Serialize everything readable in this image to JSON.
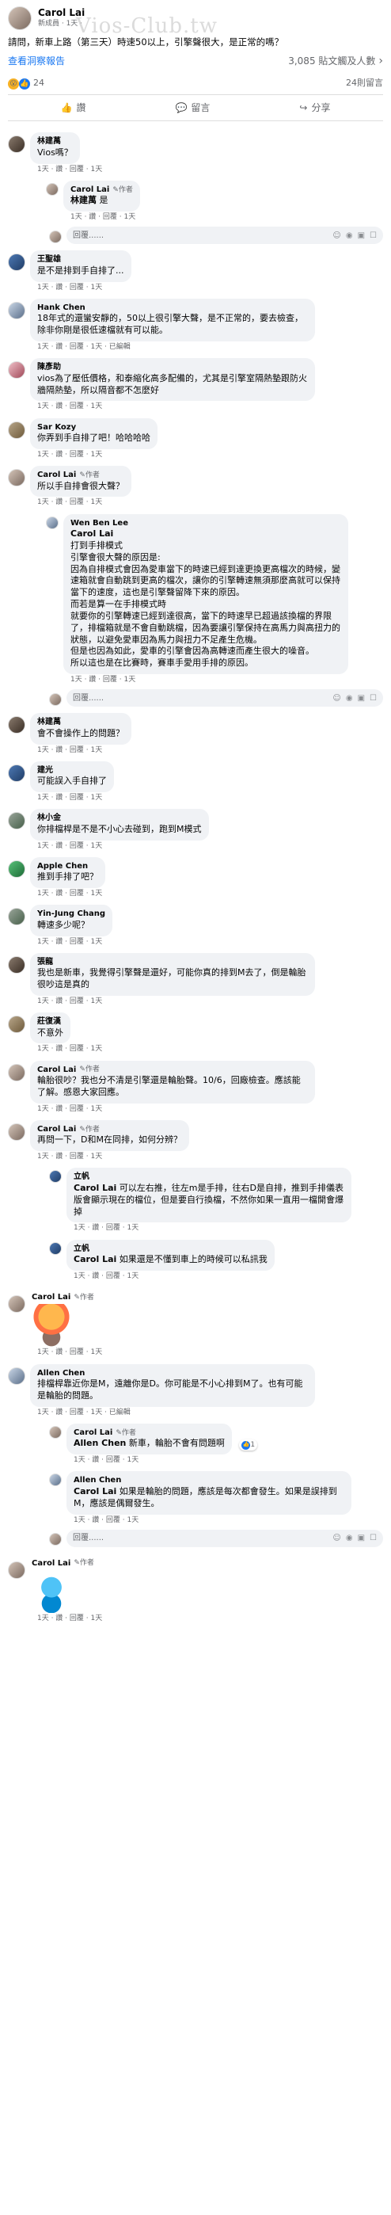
{
  "post": {
    "author": "Carol Lai",
    "meta": "新成員 · 1天 ·",
    "text": "請問，新車上路（第三天）時速50以上，引擎聲很大，是正常的嗎？",
    "watermark": "Vios-Club.tw",
    "see_insights": "查看洞察報告",
    "reach": "3,085 貼文觸及人數",
    "reaction_count": "24",
    "comment_count": "24則留言"
  },
  "actions": {
    "like": "讚",
    "comment": "留言",
    "share": "分享"
  },
  "comments": [
    {
      "id": "c1",
      "name": "林建萬",
      "text": "Vios嗎？",
      "meta": "1天 · 讚 · 回覆 · 1天"
    },
    {
      "id": "c1r1",
      "name": "Carol Lai",
      "author": "作者",
      "tag": "林建萬",
      "text": " 是",
      "meta": "1天 · 讚 · 回覆 · 1天"
    },
    {
      "id": "c2",
      "name": "王聖雄",
      "text": "是不是排到手自排了...",
      "meta": "1天 · 讚 · 回覆 · 1天"
    },
    {
      "id": "c3",
      "name": "Hank Chen",
      "text": "18年式的還蠻安靜的，50以上很引擎大聲，是不正常的，要去檢查，除非你剛是很低速檔就有可以能。",
      "meta": "1天 · 讚 · 回覆 · 1天 · 已編輯"
    },
    {
      "id": "c4",
      "name": "陳彥助",
      "text": "vios為了壓低價格，和泰縮化高多配備的，尤其是引擎室隔熱墊跟防火牆隔熱墊，所以隔音都不怎麼好",
      "meta": "1天 · 讚 · 回覆 · 1天"
    },
    {
      "id": "c5",
      "name": "Sar Kozy",
      "text": "你弄到手自排了吧！哈哈哈哈",
      "meta": "1天 · 讚 · 回覆 · 1天"
    },
    {
      "id": "c6",
      "name": "Carol Lai",
      "author": "作者",
      "text": "所以手自排會很大聲？",
      "meta": "1天 · 讚 · 回覆 · 1天"
    },
    {
      "id": "c6r1",
      "name": "Wen Ben Lee",
      "tag": "Carol Lai",
      "lines": [
        "打到手排模式",
        "引擎會很大聲的原因是:",
        "因為自排模式會因為愛車當下的時速已經到達更換更高檔次的時候，變速箱就會自動跳到更高的檔次，讓你的引擎轉速無須那麼高就可以保持當下的速度，這也是引擎聲留降下來的原因。",
        "而若是算一在手排模式時",
        "就要你的引擎轉速已經到達很高，當下的時速早已超過該換檔的界限了，排檔箱就是不會自動跳檔，因為要讓引擎保持在高馬力與高扭力的狀態，以避免愛車因為馬力與扭力不足產生危機。",
        "但是也因為如此，愛車的引擎會因為高轉速而產生很大的噪音。",
        "所以這也是在比賽時，賽車手愛用手排的原因。"
      ],
      "meta": "1天 · 讚 · 回覆 · 1天"
    },
    {
      "id": "c7",
      "name": "林建萬",
      "text": "會不會操作上的問題？",
      "meta": "1天 · 讚 · 回覆 · 1天"
    },
    {
      "id": "c8",
      "name": "建光",
      "text": "可能誤入手自排了",
      "meta": "1天 · 讚 · 回覆 · 1天"
    },
    {
      "id": "c9",
      "name": "林小金",
      "text": "你排檔桿是不是不小心去碰到，跑到M模式",
      "meta": "1天 · 讚 · 回覆 · 1天"
    },
    {
      "id": "c10",
      "name": "Apple Chen",
      "text": "推到手排了吧？",
      "meta": "1天 · 讚 · 回覆 · 1天"
    },
    {
      "id": "c11",
      "name": "Yin-Jung Chang",
      "text": "轉速多少呢？",
      "meta": "1天 · 讚 · 回覆 · 1天"
    },
    {
      "id": "c12",
      "name": "張龍",
      "text": "我也是新車，我覺得引擎聲是還好，可能你真的排到M去了，倒是輪胎很吵這是真的",
      "meta": "1天 · 讚 · 回覆 · 1天"
    },
    {
      "id": "c13",
      "name": "莊復漢",
      "text": "不意外",
      "meta": "1天 · 讚 · 回覆 · 1天"
    },
    {
      "id": "c14",
      "name": "Carol Lai",
      "author": "作者",
      "text": "輪胎很吵？我也分不清是引擎還是輪胎聲。10/6，回廠檢查。應該能了解。感恩大家回應。",
      "meta": "1天 · 讚 · 回覆 · 1天"
    },
    {
      "id": "c15",
      "name": "Carol Lai",
      "author": "作者",
      "text": "再問一下，D和M在同排，如何分辨？",
      "meta": "1天 · 讚 · 回覆 · 1天"
    },
    {
      "id": "c15r1",
      "name": "立帆",
      "tag": "Carol Lai",
      "text": " 可以左右推，往左m是手排，往右D是自排，推到手排儀表版會顯示現在的檔位，但是要自行換檔，不然你如果一直用一檔開會爆掉",
      "meta": "1天 · 讚 · 回覆 · 1天"
    },
    {
      "id": "c15r2",
      "name": "立帆",
      "tag": "Carol Lai",
      "text": " 如果還是不懂到車上的時候可以私訊我",
      "meta": "1天 · 讚 · 回覆 · 1天"
    },
    {
      "id": "c16",
      "name": "Carol Lai",
      "author": "作者",
      "sticker": true,
      "meta": "1天 · 讚 · 回覆 · 1天"
    },
    {
      "id": "c17",
      "name": "Allen Chen",
      "text": "排檔桿靠近你是M，遠離你是D。你可能是不小心排到M了。也有可能是輪胎的問題。",
      "meta": "1天 · 讚 · 回覆 · 1天 · 已編輯"
    },
    {
      "id": "c17r1",
      "name": "Carol Lai",
      "author": "作者",
      "tag": "Allen Chen",
      "text": " 新車，輪胎不會有問題啊",
      "reactions": "1",
      "meta": "1天 · 讚 · 回覆 · 1天"
    },
    {
      "id": "c17r2",
      "name": "Allen Chen",
      "tag": "Carol Lai",
      "text": " 如果是輪胎的問題，應該是每次都會發生。如果是誤排到M，應該是偶爾發生。",
      "meta": "1天 · 讚 · 回覆 · 1天"
    },
    {
      "id": "c18",
      "name": "Carol Lai",
      "author": "作者",
      "sticker2": true,
      "meta": "1天 · 讚 · 回覆 · 1天"
    }
  ],
  "reply_placeholder": "回覆......",
  "tool_icons": [
    "emoji-icon",
    "camera-icon",
    "gif-icon",
    "sticker-icon"
  ]
}
